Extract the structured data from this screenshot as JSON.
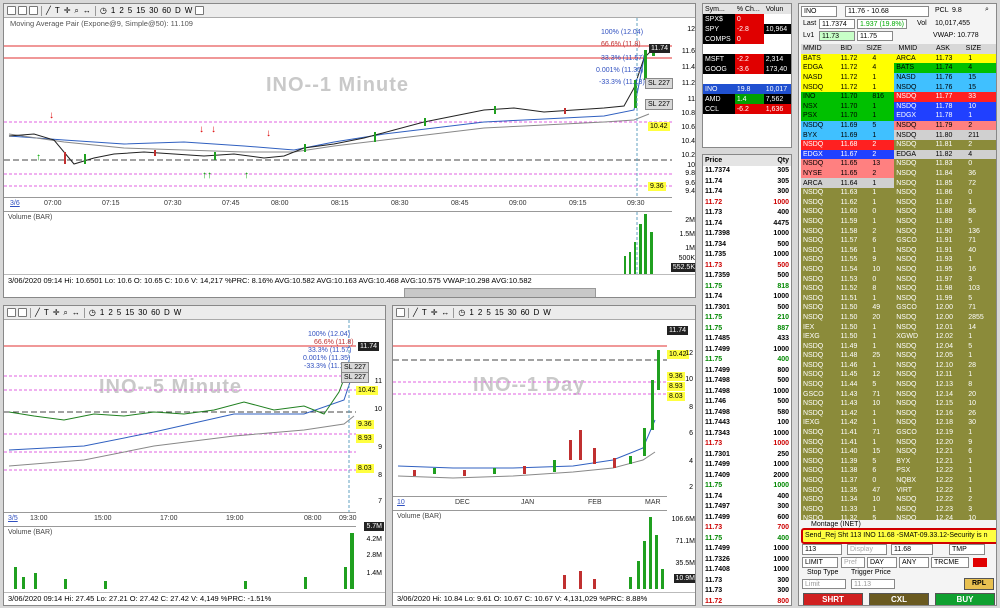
{
  "toolbar_items": [
    "1",
    "2",
    "5",
    "15",
    "30",
    "60",
    "D",
    "W"
  ],
  "top_chart": {
    "title": "Moving Average Pair (Expone@9, Simple@50): 11.109",
    "watermark": "INO--1 Minute",
    "fib": [
      "100% (12.04)",
      "66.6% (11.8)",
      "33.3% (11.57)",
      "0.001% (11.35)",
      "-33.3% (11.13)"
    ],
    "price_labels": [
      "11.74",
      "10.42",
      "9.36",
      "SL 227",
      "SL 227"
    ],
    "yticks": [
      "12",
      "11.6",
      "11.4",
      "11.2",
      "11",
      "10.8",
      "10.6",
      "10.4",
      "10.2",
      "10",
      "9.8",
      "9.6",
      "9.4"
    ],
    "xticks": [
      "07:00",
      "07:15",
      "07:30",
      "07:45",
      "08:00",
      "08:15",
      "08:30",
      "08:45",
      "09:00",
      "09:15",
      "09:30"
    ],
    "date_tag": "3/6",
    "volume_label": "Volume (BAR)",
    "vol_ticks": [
      "2M",
      "1.5M",
      "1M",
      "500K"
    ],
    "vol_last": "552.5K",
    "status": "3/06/2020 09:14  Hi: 10.6501  Lo: 10.6  O: 10.65  C: 10.6  V: 14,217 %PRC: 8.16% AVG:10.582 AVG:10.163 AVG:10.468 AVG:10.575 VWAP:10.298 AVG:10.582"
  },
  "watchlist": {
    "headers": [
      "Sym...",
      "% Ch...",
      "Volun"
    ],
    "rows": [
      {
        "sym": "SPX$",
        "chg": "0",
        "vol": ""
      },
      {
        "sym": "SPY",
        "chg": "-2.8",
        "vol": "10,964"
      },
      {
        "sym": "COMPS",
        "chg": "0",
        "vol": ""
      },
      {
        "sym": "",
        "chg": "",
        "vol": ""
      },
      {
        "sym": "MSFT",
        "chg": "-2.2",
        "vol": "2,314"
      },
      {
        "sym": "GOOG",
        "chg": "-3.6",
        "vol": "173,40"
      },
      {
        "sym": "",
        "chg": "",
        "vol": ""
      },
      {
        "sym": "INO",
        "chg": "19.8",
        "vol": "10,017"
      },
      {
        "sym": "AMD",
        "chg": "1.4",
        "vol": "7,562"
      },
      {
        "sym": "CCL",
        "chg": "-6.2",
        "vol": "1,636"
      }
    ]
  },
  "time_sales": {
    "headers": [
      "Price",
      "Qty"
    ],
    "rows": [
      {
        "p": "11.7374",
        "q": "305",
        "c": "#000"
      },
      {
        "p": "11.74",
        "q": "305",
        "c": "#000"
      },
      {
        "p": "11.74",
        "q": "300",
        "c": "#000"
      },
      {
        "p": "11.72",
        "q": "1000",
        "c": "#c00"
      },
      {
        "p": "11.73",
        "q": "400",
        "c": "#000"
      },
      {
        "p": "11.74",
        "q": "4475",
        "c": "#000"
      },
      {
        "p": "11.7398",
        "q": "1000",
        "c": "#000"
      },
      {
        "p": "11.734",
        "q": "500",
        "c": "#000"
      },
      {
        "p": "11.735",
        "q": "1000",
        "c": "#000"
      },
      {
        "p": "11.73",
        "q": "500",
        "c": "#c00"
      },
      {
        "p": "11.7359",
        "q": "500",
        "c": "#000"
      },
      {
        "p": "11.75",
        "q": "818",
        "c": "#080"
      },
      {
        "p": "11.74",
        "q": "1000",
        "c": "#000"
      },
      {
        "p": "11.7301",
        "q": "500",
        "c": "#000"
      },
      {
        "p": "11.75",
        "q": "210",
        "c": "#080"
      },
      {
        "p": "11.75",
        "q": "887",
        "c": "#080"
      },
      {
        "p": "11.7485",
        "q": "433",
        "c": "#000"
      },
      {
        "p": "11.7499",
        "q": "1000",
        "c": "#000"
      },
      {
        "p": "11.75",
        "q": "400",
        "c": "#080"
      },
      {
        "p": "11.7499",
        "q": "800",
        "c": "#000"
      },
      {
        "p": "11.7498",
        "q": "500",
        "c": "#000"
      },
      {
        "p": "11.7498",
        "q": "1000",
        "c": "#000"
      },
      {
        "p": "11.746",
        "q": "500",
        "c": "#000"
      },
      {
        "p": "11.7498",
        "q": "580",
        "c": "#000"
      },
      {
        "p": "11.7443",
        "q": "100",
        "c": "#000"
      },
      {
        "p": "11.7343",
        "q": "1000",
        "c": "#000"
      },
      {
        "p": "11.73",
        "q": "1000",
        "c": "#c00"
      },
      {
        "p": "11.7301",
        "q": "250",
        "c": "#000"
      },
      {
        "p": "11.7499",
        "q": "1000",
        "c": "#000"
      },
      {
        "p": "11.7409",
        "q": "2000",
        "c": "#000"
      },
      {
        "p": "11.75",
        "q": "1000",
        "c": "#080"
      },
      {
        "p": "11.74",
        "q": "400",
        "c": "#000"
      },
      {
        "p": "11.7497",
        "q": "300",
        "c": "#000"
      },
      {
        "p": "11.7499",
        "q": "600",
        "c": "#000"
      },
      {
        "p": "11.73",
        "q": "700",
        "c": "#c00"
      },
      {
        "p": "11.75",
        "q": "400",
        "c": "#080"
      },
      {
        "p": "11.7499",
        "q": "1000",
        "c": "#000"
      },
      {
        "p": "11.7326",
        "q": "1000",
        "c": "#000"
      },
      {
        "p": "11.7408",
        "q": "1000",
        "c": "#000"
      },
      {
        "p": "11.73",
        "q": "300",
        "c": "#000"
      },
      {
        "p": "11.73",
        "q": "300",
        "c": "#000"
      },
      {
        "p": "11.72",
        "q": "800",
        "c": "#c00"
      }
    ]
  },
  "chart5": {
    "watermark": "INO--5 Minute",
    "fib": [
      "100% (12.04)",
      "66.6% (11.8)",
      "33.3% (11.57)",
      "0.001% (11.35)",
      "-33.3% (11.13)"
    ],
    "price_labels": [
      "11.74",
      "10.42",
      "9.36",
      "8.93",
      "8.03",
      "SL 227",
      "SL 227"
    ],
    "yticks": [
      "11",
      "10",
      "9",
      "8",
      "7"
    ],
    "xticks": [
      "13:00",
      "15:00",
      "17:00",
      "19:00",
      "08:00",
      "09:30"
    ],
    "date_tag": "3/5",
    "volume_label": "Volume (BAR)",
    "vol_ticks": [
      "4.2M",
      "2.8M",
      "1.4M"
    ],
    "vol_last": "5.7M",
    "status": "3/06/2020 09:14  Hi: 27.45  Lo: 27.21  O: 27.42  C: 27.42  V: 4,149 %PRC: -1.51%"
  },
  "chart_day": {
    "watermark": "INO--1 Day",
    "price_labels": [
      "11.74",
      "10.42",
      "9.36",
      "8.93",
      "8.03"
    ],
    "yticks": [
      "12",
      "10",
      "8",
      "6",
      "4",
      "2"
    ],
    "xticks": [
      "DEC",
      "JAN",
      "FEB",
      "MAR"
    ],
    "date_tag": "10",
    "volume_label": "Volume (BAR)",
    "vol_ticks": [
      "106.6M",
      "71.1M",
      "35.5M"
    ],
    "vol_last": "10.9M",
    "status": "3/06/2020  Hi: 10.84  Lo: 9.61  O: 10.67  C: 10.67  V: 4,131,029 %PRC: 8.88%"
  },
  "level2": {
    "symbol": "INO",
    "range": "11.76 - 10.68",
    "pcl_label": "PCL",
    "pcl": "9.8",
    "last_label": "Last",
    "last": "11.7374",
    "chg": "1.937 (19.8%)",
    "vol_label": "Vol",
    "vol": "10,017,455",
    "lv1_label": "Lv1",
    "lv1_bid": "11.73",
    "lv1_ask": "11.75",
    "vwap": "VWAP: 10.778",
    "headers": [
      "MMID",
      "BID",
      "SIZE",
      "MMID",
      "ASK",
      "SIZE"
    ],
    "rows": [
      {
        "bm": "BATS",
        "bp": "11.72",
        "bs": "4",
        "bc": "#ffff00",
        "am": "ARCA",
        "ap": "11.73",
        "as": "1",
        "ac": "#ffff00"
      },
      {
        "bm": "EDGA",
        "bp": "11.72",
        "bs": "4",
        "bc": "#ffff00",
        "am": "BATS",
        "ap": "11.74",
        "as": "4",
        "ac": "#00c000"
      },
      {
        "bm": "NASD",
        "bp": "11.72",
        "bs": "1",
        "bc": "#ffff00",
        "am": "NASD",
        "ap": "11.76",
        "as": "15",
        "ac": "#40c0ff"
      },
      {
        "bm": "NSDQ",
        "bp": "11.72",
        "bs": "1",
        "bc": "#ffff00",
        "am": "NSDQ",
        "ap": "11.76",
        "as": "15",
        "ac": "#40c0ff"
      },
      {
        "bm": "INO",
        "bp": "11.70",
        "bs": "816",
        "bc": "#00c000",
        "am": "NSDQ",
        "ap": "11.77",
        "as": "33",
        "ac": "#ff2020"
      },
      {
        "bm": "NSX",
        "bp": "11.70",
        "bs": "1",
        "bc": "#00c000",
        "am": "NSDQ",
        "ap": "11.78",
        "as": "10",
        "ac": "#2040ff"
      },
      {
        "bm": "PSX",
        "bp": "11.70",
        "bs": "1",
        "bc": "#00c000",
        "am": "EDGX",
        "ap": "11.78",
        "as": "1",
        "ac": "#2040ff"
      },
      {
        "bm": "NSDQ",
        "bp": "11.69",
        "bs": "5",
        "bc": "#40c0ff",
        "am": "NSDQ",
        "ap": "11.79",
        "as": "2",
        "ac": "#ff8080"
      },
      {
        "bm": "BYX",
        "bp": "11.69",
        "bs": "1",
        "bc": "#40c0ff",
        "am": "NSDQ",
        "ap": "11.80",
        "as": "211",
        "ac": "#d0d0d0"
      },
      {
        "bm": "NSDQ",
        "bp": "11.68",
        "bs": "2",
        "bc": "#ff2020",
        "am": "NSDQ",
        "ap": "11.81",
        "as": "2",
        "ac": "#8b8b3a"
      },
      {
        "bm": "EDGX",
        "bp": "11.67",
        "bs": "2",
        "bc": "#2040ff",
        "am": "EDGA",
        "ap": "11.82",
        "as": "4",
        "ac": "#d0d0d0"
      },
      {
        "bm": "NSDQ",
        "bp": "11.65",
        "bs": "13",
        "bc": "#ff8080",
        "am": "NSDQ",
        "ap": "11.83",
        "as": "0",
        "ac": "#8b8b3a"
      },
      {
        "bm": "NYSE",
        "bp": "11.65",
        "bs": "2",
        "bc": "#ff8080",
        "am": "NSDQ",
        "ap": "11.84",
        "as": "36",
        "ac": "#8b8b3a"
      },
      {
        "bm": "ARCA",
        "bp": "11.64",
        "bs": "1",
        "bc": "#d0d0d0",
        "am": "NSDQ",
        "ap": "11.85",
        "as": "72",
        "ac": "#8b8b3a"
      },
      {
        "bm": "NSDQ",
        "bp": "11.63",
        "bs": "1",
        "bc": "#8b8b3a",
        "am": "NSDQ",
        "ap": "11.86",
        "as": "0",
        "ac": "#8b8b3a"
      },
      {
        "bm": "NSDQ",
        "bp": "11.62",
        "bs": "1",
        "bc": "#8b8b3a",
        "am": "NSDQ",
        "ap": "11.87",
        "as": "1",
        "ac": "#8b8b3a"
      },
      {
        "bm": "NSDQ",
        "bp": "11.60",
        "bs": "0",
        "bc": "#8b8b3a",
        "am": "NSDQ",
        "ap": "11.88",
        "as": "86",
        "ac": "#8b8b3a"
      },
      {
        "bm": "NSDQ",
        "bp": "11.59",
        "bs": "1",
        "bc": "#8b8b3a",
        "am": "NSDQ",
        "ap": "11.89",
        "as": "5",
        "ac": "#8b8b3a"
      },
      {
        "bm": "NSDQ",
        "bp": "11.58",
        "bs": "2",
        "bc": "#8b8b3a",
        "am": "NSDQ",
        "ap": "11.90",
        "as": "136",
        "ac": "#8b8b3a"
      },
      {
        "bm": "NSDQ",
        "bp": "11.57",
        "bs": "6",
        "bc": "#8b8b3a",
        "am": "GSCO",
        "ap": "11.91",
        "as": "71",
        "ac": "#8b8b3a"
      },
      {
        "bm": "NSDQ",
        "bp": "11.56",
        "bs": "1",
        "bc": "#8b8b3a",
        "am": "NSDQ",
        "ap": "11.91",
        "as": "40",
        "ac": "#8b8b3a"
      },
      {
        "bm": "NSDQ",
        "bp": "11.55",
        "bs": "9",
        "bc": "#8b8b3a",
        "am": "NSDQ",
        "ap": "11.93",
        "as": "1",
        "ac": "#8b8b3a"
      },
      {
        "bm": "NSDQ",
        "bp": "11.54",
        "bs": "10",
        "bc": "#8b8b3a",
        "am": "NSDQ",
        "ap": "11.95",
        "as": "16",
        "ac": "#8b8b3a"
      },
      {
        "bm": "NSDQ",
        "bp": "11.53",
        "bs": "0",
        "bc": "#8b8b3a",
        "am": "NSDQ",
        "ap": "11.97",
        "as": "3",
        "ac": "#8b8b3a"
      },
      {
        "bm": "NSDQ",
        "bp": "11.52",
        "bs": "8",
        "bc": "#8b8b3a",
        "am": "NSDQ",
        "ap": "11.98",
        "as": "103",
        "ac": "#8b8b3a"
      },
      {
        "bm": "NSDQ",
        "bp": "11.51",
        "bs": "1",
        "bc": "#8b8b3a",
        "am": "NSDQ",
        "ap": "11.99",
        "as": "5",
        "ac": "#8b8b3a"
      },
      {
        "bm": "NSDQ",
        "bp": "11.50",
        "bs": "49",
        "bc": "#8b8b3a",
        "am": "GSCO",
        "ap": "12.00",
        "as": "71",
        "ac": "#8b8b3a"
      },
      {
        "bm": "NSDQ",
        "bp": "11.50",
        "bs": "20",
        "bc": "#8b8b3a",
        "am": "NSDQ",
        "ap": "12.00",
        "as": "2855",
        "ac": "#8b8b3a"
      },
      {
        "bm": "IEX",
        "bp": "11.50",
        "bs": "1",
        "bc": "#8b8b3a",
        "am": "NSDQ",
        "ap": "12.01",
        "as": "14",
        "ac": "#8b8b3a"
      },
      {
        "bm": "IEXG",
        "bp": "11.50",
        "bs": "1",
        "bc": "#8b8b3a",
        "am": "XGWD",
        "ap": "12.02",
        "as": "1",
        "ac": "#8b8b3a"
      },
      {
        "bm": "NSDQ",
        "bp": "11.49",
        "bs": "1",
        "bc": "#8b8b3a",
        "am": "NSDQ",
        "ap": "12.04",
        "as": "5",
        "ac": "#8b8b3a"
      },
      {
        "bm": "NSDQ",
        "bp": "11.48",
        "bs": "25",
        "bc": "#8b8b3a",
        "am": "NSDQ",
        "ap": "12.05",
        "as": "1",
        "ac": "#8b8b3a"
      },
      {
        "bm": "NSDQ",
        "bp": "11.46",
        "bs": "1",
        "bc": "#8b8b3a",
        "am": "NSDQ",
        "ap": "12.10",
        "as": "28",
        "ac": "#8b8b3a"
      },
      {
        "bm": "NSDQ",
        "bp": "11.45",
        "bs": "12",
        "bc": "#8b8b3a",
        "am": "NSDQ",
        "ap": "12.11",
        "as": "1",
        "ac": "#8b8b3a"
      },
      {
        "bm": "NSDQ",
        "bp": "11.44",
        "bs": "5",
        "bc": "#8b8b3a",
        "am": "NSDQ",
        "ap": "12.13",
        "as": "8",
        "ac": "#8b8b3a"
      },
      {
        "bm": "GSCO",
        "bp": "11.43",
        "bs": "71",
        "bc": "#8b8b3a",
        "am": "NSDQ",
        "ap": "12.14",
        "as": "20",
        "ac": "#8b8b3a"
      },
      {
        "bm": "NSDQ",
        "bp": "11.43",
        "bs": "10",
        "bc": "#8b8b3a",
        "am": "NSDQ",
        "ap": "12.15",
        "as": "10",
        "ac": "#8b8b3a"
      },
      {
        "bm": "NSDQ",
        "bp": "11.42",
        "bs": "1",
        "bc": "#8b8b3a",
        "am": "NSDQ",
        "ap": "12.16",
        "as": "26",
        "ac": "#8b8b3a"
      },
      {
        "bm": "IEXG",
        "bp": "11.42",
        "bs": "1",
        "bc": "#8b8b3a",
        "am": "NSDQ",
        "ap": "12.18",
        "as": "30",
        "ac": "#8b8b3a"
      },
      {
        "bm": "NSDQ",
        "bp": "11.41",
        "bs": "71",
        "bc": "#8b8b3a",
        "am": "GSCO",
        "ap": "12.19",
        "as": "1",
        "ac": "#8b8b3a"
      },
      {
        "bm": "NSDQ",
        "bp": "11.41",
        "bs": "1",
        "bc": "#8b8b3a",
        "am": "NSDQ",
        "ap": "12.20",
        "as": "9",
        "ac": "#8b8b3a"
      },
      {
        "bm": "NSDQ",
        "bp": "11.40",
        "bs": "15",
        "bc": "#8b8b3a",
        "am": "NSDQ",
        "ap": "12.21",
        "as": "6",
        "ac": "#8b8b3a"
      },
      {
        "bm": "NSDQ",
        "bp": "11.39",
        "bs": "5",
        "bc": "#8b8b3a",
        "am": "BYX",
        "ap": "12.21",
        "as": "1",
        "ac": "#8b8b3a"
      },
      {
        "bm": "NSDQ",
        "bp": "11.38",
        "bs": "6",
        "bc": "#8b8b3a",
        "am": "PSX",
        "ap": "12.22",
        "as": "1",
        "ac": "#8b8b3a"
      },
      {
        "bm": "NSDQ",
        "bp": "11.37",
        "bs": "0",
        "bc": "#8b8b3a",
        "am": "NQBX",
        "ap": "12.22",
        "as": "1",
        "ac": "#8b8b3a"
      },
      {
        "bm": "NSDQ",
        "bp": "11.35",
        "bs": "47",
        "bc": "#8b8b3a",
        "am": "VIRT",
        "ap": "12.22",
        "as": "1",
        "ac": "#8b8b3a"
      },
      {
        "bm": "NSDQ",
        "bp": "11.34",
        "bs": "10",
        "bc": "#8b8b3a",
        "am": "NSDQ",
        "ap": "12.22",
        "as": "2",
        "ac": "#8b8b3a"
      },
      {
        "bm": "NSDQ",
        "bp": "11.33",
        "bs": "1",
        "bc": "#8b8b3a",
        "am": "NSDQ",
        "ap": "12.23",
        "as": "3",
        "ac": "#8b8b3a"
      },
      {
        "bm": "NSDQ",
        "bp": "11.32",
        "bs": "5",
        "bc": "#8b8b3a",
        "am": "NSDQ",
        "ap": "12.24",
        "as": "10",
        "ac": "#8b8b3a"
      },
      {
        "bm": "NSDQ",
        "bp": "11.30",
        "bs": "1",
        "bc": "#8b8b3a",
        "am": "XGWD",
        "ap": "12.25",
        "as": "1",
        "ac": "#8b8b3a"
      }
    ],
    "montage_label": "Montage (INET)",
    "alert": "Send_Rej Sht 113 INO 11.68 -SMAT-09.33.12-Security is n",
    "order_qty": "113",
    "display_label": "Display",
    "order_price": "11.68",
    "route": "TMP",
    "order_type": "LIMIT",
    "pref_label": "Pref",
    "tif": "DAY",
    "tif2": "ANY",
    "algo": "TRCME",
    "stop_type_label": "Stop Type",
    "trigger_label": "Trigger Price",
    "stop_value": "Limit",
    "trigger_value": "11.13",
    "rpl_label": "RPL",
    "short_label": "SHRT",
    "cxl_label": "CXL",
    "buy_label": "BUY"
  }
}
